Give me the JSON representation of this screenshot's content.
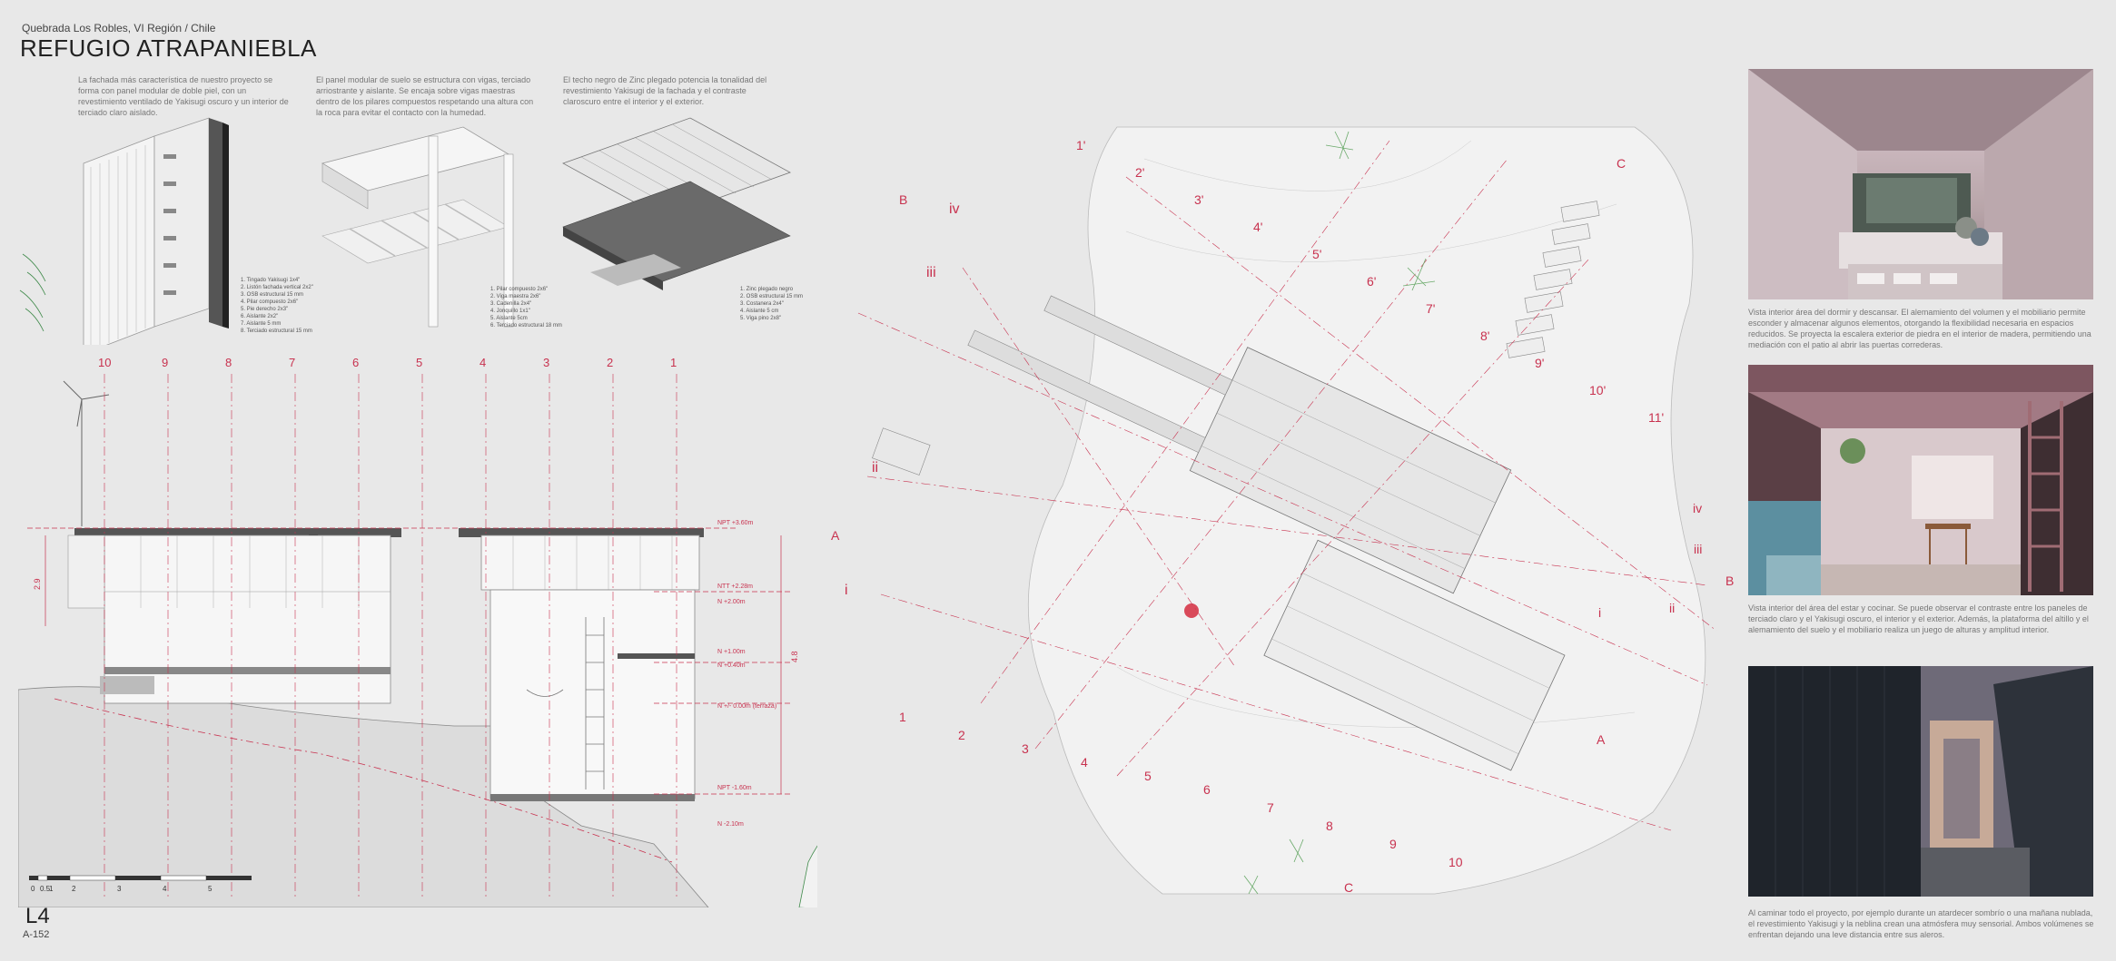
{
  "header": {
    "subtitle": "Quebrada Los Robles, VI Región / Chile",
    "title": "REFUGIO ATRAPANIEBLA"
  },
  "axo_blurbs": [
    "La fachada más característica de nuestro proyecto se forma con panel modular de doble piel, con un revestimiento ventilado de Yakisugi oscuro y un interior de terciado claro aislado.",
    "El panel modular de suelo se estructura con vigas, terciado arriostrante y aislante. Se encaja sobre vigas maestras dentro de los pilares compuestos respetando una altura con la roca para evitar el contacto con la humedad.",
    "El techo negro de Zinc plegado potencia la tonalidad del revestimiento Yakisugi de la fachada y el contraste claroscuro entre el interior y el exterior."
  ],
  "axo_legends": [
    [
      "1. Tingado Yakisugi 1x4\"",
      "2. Listón fachada vertical 2x2\"",
      "3. OSB estructural 15 mm",
      "4. Pilar compuesto 2x6\"",
      "5. Pie derecho 2x3\"",
      "6. Aislante 2x2\"",
      "7. Aislante 5 mm",
      "8. Terciado estructural 15 mm"
    ],
    [
      "1. Pilar compuesto 2x6\"",
      "2. Viga maestra 2x6\"",
      "3. Cadenilla 2x4\"",
      "4. Jonquillo 1x1\"",
      "5. Aislante 5cm",
      "6. Terciado estructural 18 mm"
    ],
    [
      "1. Zinc plegado negro",
      "2. OSB estructural 15 mm",
      "3. Costanera 2x4\"",
      "4. Aislante 5 cm",
      "5. Viga pino 2x8\""
    ]
  ],
  "section": {
    "axis_labels": [
      "10",
      "9",
      "8",
      "7",
      "6",
      "5",
      "4",
      "3",
      "2",
      "1"
    ],
    "levels": [
      "NPT +3.60m",
      "NTT +2.28m",
      "N +2.00m",
      "N +1.00m",
      "N +0.40m",
      "N +/- 0.00m (terraza)",
      "NPT -1.60m",
      "N -2.10m"
    ],
    "dims": [
      "2.9",
      "4.8"
    ],
    "scale_ticks": [
      "0",
      "0.5",
      "1",
      "2",
      "3",
      "4",
      "5"
    ]
  },
  "plan": {
    "primed_axes": [
      "1'",
      "2'",
      "3'",
      "4'",
      "5'",
      "6'",
      "7'",
      "8'",
      "9'",
      "10'",
      "11'"
    ],
    "bottom_axes": [
      "1",
      "2",
      "3",
      "4",
      "5",
      "6",
      "7",
      "8",
      "9",
      "10"
    ],
    "roman_axes": [
      "i",
      "ii",
      "iii",
      "iv"
    ],
    "section_marks": [
      "A",
      "B",
      "C"
    ]
  },
  "renders": [
    {
      "caption": "Vista interior área del dormir y descansar. El alemamiento del volumen y el mobiliario permite esconder y almacenar algunos elementos, otorgando la flexibilidad necesaria en espacios reducidos. Se proyecta la escalera exterior de piedra en el interior de madera, permitiendo una mediación con el patio al abrir las puertas correderas."
    },
    {
      "caption": "Vista interior del área del estar y cocinar. Se puede observar el contraste entre los paneles de terciado claro y el Yakisugi oscuro, el interior y el exterior. Además, la plataforma del altillo y el alemamiento del suelo y el mobiliario realiza un juego de alturas y amplitud interior."
    },
    {
      "caption": "Al caminar todo el proyecto, por ejemplo durante un atardecer sombrío o una mañana nublada, el revestimiento Yakisugi y la neblina crean una atmósfera muy sensorial. Ambos volúmenes se enfrentan dejando una leve distancia entre sus aleros."
    }
  ],
  "footer": {
    "sheet_code": "L4",
    "sheet_number": "A-152"
  },
  "colors": {
    "accent_red": "#c8324f",
    "background": "#e8e8e8",
    "vegetation": "#3f8a4a"
  }
}
